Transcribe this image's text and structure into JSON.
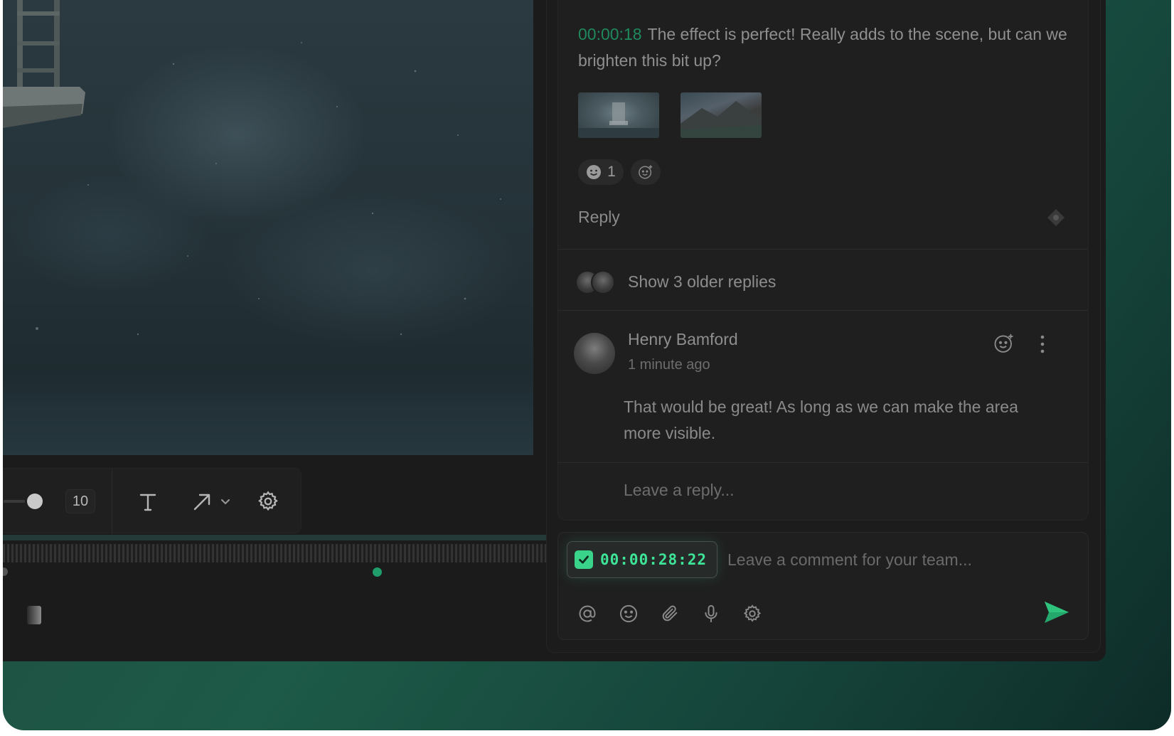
{
  "toolbar": {
    "brush_size": "10",
    "icons": [
      "text-icon",
      "arrow-icon",
      "chevron-down-icon",
      "settings-icon"
    ]
  },
  "comment": {
    "timestamp": "00:00:18",
    "text": "The effect is perfect! Really adds to the scene, but can we brighten this bit up?",
    "reaction_count": "1",
    "reply_label": "Reply"
  },
  "thread": {
    "older_replies_label": "Show 3 older replies",
    "reply": {
      "author": "Henry Bamford",
      "time": "1 minute ago",
      "text": "That would be great! As long as we can make the area more visible."
    },
    "reply_placeholder": "Leave a reply..."
  },
  "composer": {
    "timestamp": "00:00:28:22",
    "placeholder": "Leave a comment for your team...",
    "tools": [
      "mention-icon",
      "emoji-icon",
      "attachment-icon",
      "microphone-icon",
      "settings-icon"
    ]
  },
  "colors": {
    "accent": "#3ee598",
    "timestamp_muted": "#1f8a5e",
    "background": "#1b1b1b"
  }
}
